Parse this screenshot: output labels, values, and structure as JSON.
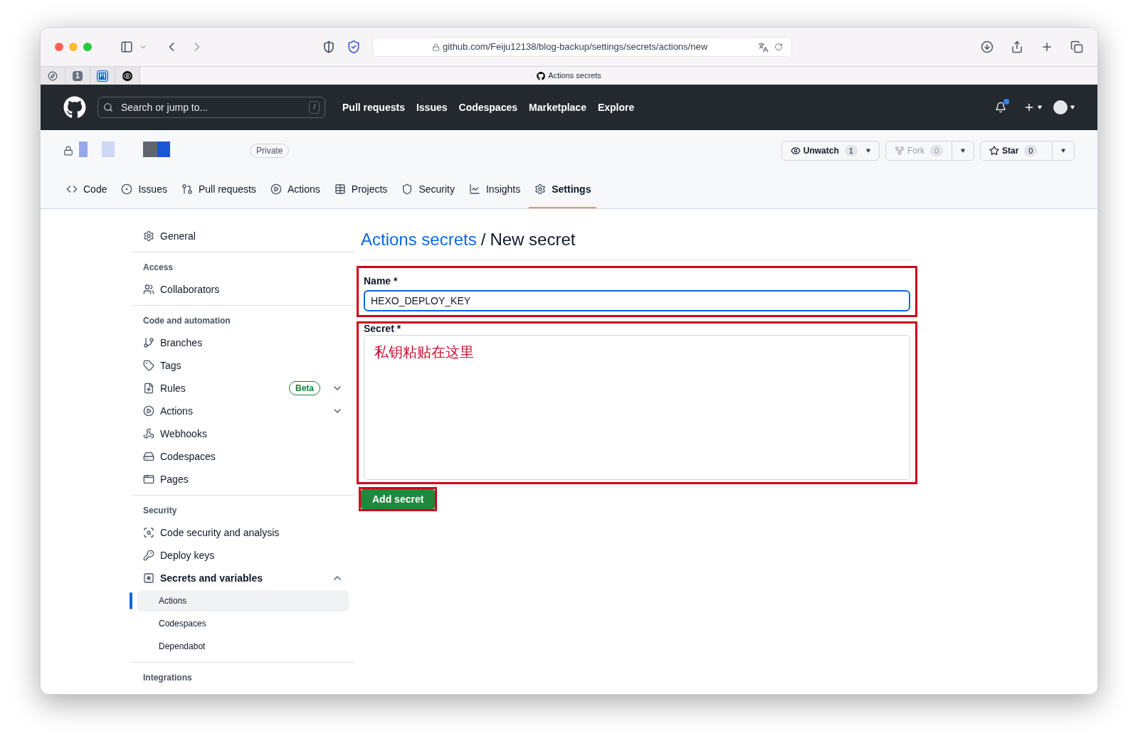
{
  "browser": {
    "url": "github.com/Feiju12138/blog-backup/settings/secrets/actions/new",
    "tab_title": "Actions secrets",
    "pinned_tabs": [
      {
        "kind": "compass"
      },
      {
        "kind": "badge",
        "label": "1"
      },
      {
        "kind": "board"
      },
      {
        "kind": "eye"
      }
    ]
  },
  "header": {
    "search_placeholder": "Search or jump to...",
    "search_key": "/",
    "nav": [
      "Pull requests",
      "Issues",
      "Codespaces",
      "Marketplace",
      "Explore"
    ],
    "notification_unread": true
  },
  "repo": {
    "visibility": "Private",
    "actions": [
      {
        "kind": "watch",
        "label": "Unwatch",
        "count": "1",
        "disabled": false
      },
      {
        "kind": "fork",
        "label": "Fork",
        "count": "0",
        "disabled": true
      },
      {
        "kind": "star",
        "label": "Star",
        "count": "0",
        "disabled": false
      }
    ],
    "tabs": [
      {
        "kind": "code",
        "label": "Code",
        "selected": false
      },
      {
        "kind": "issues",
        "label": "Issues",
        "selected": false
      },
      {
        "kind": "pulls",
        "label": "Pull requests",
        "selected": false
      },
      {
        "kind": "actions",
        "label": "Actions",
        "selected": false
      },
      {
        "kind": "projects",
        "label": "Projects",
        "selected": false
      },
      {
        "kind": "security",
        "label": "Security",
        "selected": false
      },
      {
        "kind": "insights",
        "label": "Insights",
        "selected": false
      },
      {
        "kind": "settings",
        "label": "Settings",
        "selected": true
      }
    ]
  },
  "sidebar": {
    "groups": [
      {
        "items": [
          {
            "label": "General"
          }
        ]
      },
      {
        "heading": "Access",
        "items": [
          {
            "label": "Collaborators"
          }
        ]
      },
      {
        "heading": "Code and automation",
        "items": [
          {
            "label": "Branches"
          },
          {
            "label": "Tags"
          },
          {
            "label": "Rules",
            "badge": "Beta",
            "expanded": false
          },
          {
            "label": "Actions",
            "expanded": false
          },
          {
            "label": "Webhooks"
          },
          {
            "label": "Codespaces"
          },
          {
            "label": "Pages"
          }
        ]
      },
      {
        "heading": "Security",
        "items": [
          {
            "label": "Code security and analysis"
          },
          {
            "label": "Deploy keys"
          },
          {
            "label": "Secrets and variables",
            "expanded": true,
            "children": [
              {
                "label": "Actions",
                "selected": true
              },
              {
                "label": "Codespaces",
                "selected": false
              },
              {
                "label": "Dependabot",
                "selected": false
              }
            ]
          }
        ]
      },
      {
        "heading": "Integrations"
      }
    ]
  },
  "main": {
    "breadcrumb_link": "Actions secrets",
    "separator": "/",
    "title": "New secret",
    "name_field": {
      "label": "Name *",
      "value": "HEXO_DEPLOY_KEY",
      "focused": true,
      "highlighted": true
    },
    "secret_field": {
      "label": "Secret *",
      "value": "私钥粘贴在这里",
      "highlighted": true
    },
    "submit": {
      "label": "Add secret",
      "highlighted": true
    }
  }
}
